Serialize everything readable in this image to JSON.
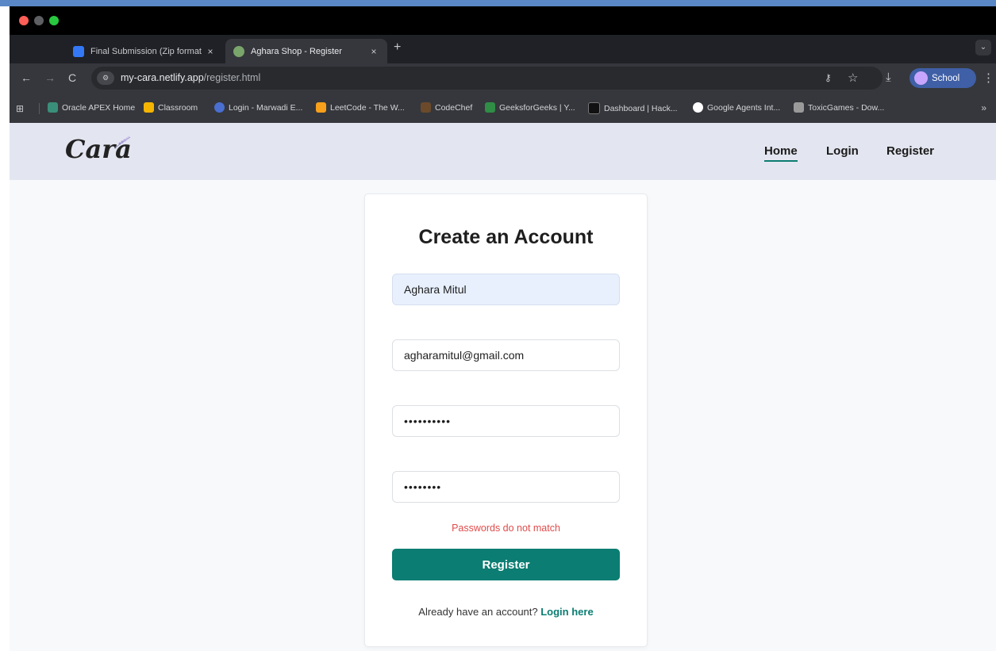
{
  "browser": {
    "tabs": [
      {
        "title": "Final Submission (Zip format",
        "close": "×"
      },
      {
        "title": "Aghara Shop - Register",
        "close": "×"
      }
    ],
    "new_tab": "+",
    "url_host": "my-cara.netlify.app",
    "url_path": "/register.html",
    "profile_name": "School",
    "bookmarks": [
      "Oracle APEX Home",
      "Classroom",
      "Login - Marwadi E...",
      "LeetCode - The W...",
      "CodeChef",
      "GeeksforGeeks | Y...",
      "Dashboard | Hack...",
      "Google Agents Int...",
      "ToxicGames - Dow..."
    ],
    "bookmarks_more": "»"
  },
  "site": {
    "logo": "Cara",
    "nav": {
      "home": "Home",
      "login": "Login",
      "register": "Register"
    }
  },
  "form": {
    "title": "Create an Account",
    "name_value": "Aghara Mitul",
    "email_value": "agharamitul@gmail.com",
    "password_value": "••••••••••",
    "confirm_value": "••••••••",
    "error": "Passwords do not match",
    "submit": "Register",
    "footer_text": "Already have an account? ",
    "footer_link": "Login here"
  }
}
